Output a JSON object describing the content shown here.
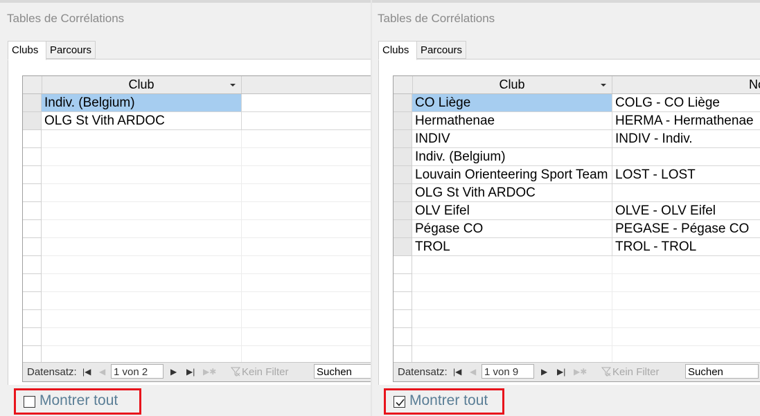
{
  "panels": [
    {
      "title": "Tables de Corrélations",
      "tabs": [
        "Clubs",
        "Parcours"
      ],
      "columns": [
        "Club",
        ""
      ],
      "rows": [
        [
          "Indiv. (Belgium)",
          ""
        ],
        [
          "OLG St Vith ARDOC",
          ""
        ]
      ],
      "selected_row": 0,
      "nav": {
        "label": "Datensatz:",
        "position": "1 von 2",
        "filter": "Kein Filter",
        "search": "Suchen"
      },
      "show_all": {
        "label": "Montrer tout",
        "checked": false
      }
    },
    {
      "title": "Tables de Corrélations",
      "tabs": [
        "Clubs",
        "Parcours"
      ],
      "columns": [
        "Club",
        "No"
      ],
      "rows": [
        [
          "CO Liège",
          "COLG - CO Liège"
        ],
        [
          "Hermathenae",
          "HERMA - Hermathenae"
        ],
        [
          "INDIV",
          "INDIV - Indiv."
        ],
        [
          "Indiv. (Belgium)",
          ""
        ],
        [
          "Louvain Orienteering Sport Team",
          "LOST - LOST"
        ],
        [
          "OLG St Vith ARDOC",
          ""
        ],
        [
          "OLV Eifel",
          "OLVE - OLV Eifel"
        ],
        [
          "Pégase CO",
          "PEGASE - Pégase CO"
        ],
        [
          "TROL",
          "TROL - TROL"
        ]
      ],
      "selected_row": 0,
      "nav": {
        "label": "Datensatz:",
        "position": "1 von 9",
        "filter": "Kein Filter",
        "search": "Suchen"
      },
      "show_all": {
        "label": "Montrer tout",
        "checked": true
      }
    }
  ]
}
